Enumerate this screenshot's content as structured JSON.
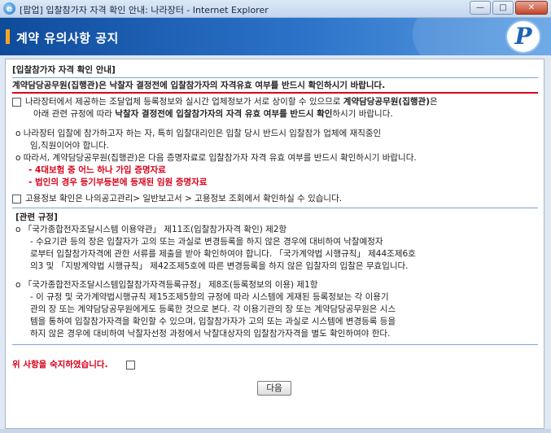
{
  "window": {
    "title": "[팝업] 입찰참가자 자격 확인 안내: 나라장터 - Internet Explorer",
    "minimize": "—",
    "maximize": "□",
    "close": "✕"
  },
  "header": {
    "title": "계약 유의사항 공지",
    "logo_letter": "P"
  },
  "content": {
    "section_title": "[입찰참가자 자격 확인 안내]",
    "main_notice": "계약담당공무원(집행관)은 낙찰자 결정전에 입찰참가자의 자격유효 여부를 반드시 확인하시기 바랍니다.",
    "p1_line1_a": "나라장터에서 제공하는 조달업체 등록정보와 실시간 업체정보가 서로 상이할 수 있으므로 ",
    "p1_line1_b": "계약담당공무원(집행관)",
    "p1_line1_c": "은",
    "p1_line2_a": "아래 관련 규정에 따라 ",
    "p1_line2_b": "낙찰자 결정전에 입찰참가자의 자격 유효 여부를 반드시 확인",
    "p1_line2_c": "하시기 바랍니다.",
    "p2_line1": "o 나라장터 입찰에 참가하고자 하는 자, 특히 입찰대리인은 입찰 당시 반드시 입찰참가 업체에 재직중인",
    "p2_line2": "임,직원이어야 합니다.",
    "p3_line1": "o 따라서, 계약담당공무원(집행관)은 다음 증명자료로 입찰참가자 자격 유효 여부를 반드시 확인하시기 바랍니다.",
    "p3_item1": "- 4대보험 중 어느 하나 가입 증명자료",
    "p3_item2": "- 법인의 경우 등기부등본에 등재된 임원 증명자료",
    "p4_line1": "고용정보 확인은 나의공고관리> 일반보고서 > 고용정보 조회에서 확인하실 수 있습니다.",
    "rel_title": "[관련 규정]",
    "r1_line1": "o 「국가종합전자조달시스템 이용약관」 제11조(입찰참가자격 확인) 제2항",
    "r1_line2": "- 수요기관 등의 장은 입찰자가 고의 또는 과실로 변경등록을 하지 않은 경우에 대비하여 낙찰예정자",
    "r1_line3": "로부터 입찰참가자격에 관한 서류를 제출을 받아 확인하여야 합니다. 「국가계약법 시행규칙」 제44조제6호",
    "r1_line4": "의3 및 「지방계약법 시행규칙」 제42조제5호에 따른 변경등록을 하지 않은 입찰자의 입찰은 무효입니다.",
    "r2_line1": "o 「국가종합전자조달시스템입찰참가자격등록규정」 제8조(등록정보의 이용) 제1항",
    "r2_line2": "- 이 규정 및 국가계약법시행규칙 제15조제5항의 규정에 따라 시스템에 게재된 등록정보는 각 이용기",
    "r2_line3": "관의 장 또는 계약담당공무원에게도 등록한 것으로 본다. 각 이용기관의 장 또는 계약담당공무원은 시스",
    "r2_line4": "템을 통하여 입찰참가자격을 확인할 수 있으며, 입찰참가자가 고의 또는 과실로 시스템에 변경등록 등을",
    "r2_line5": "하지 않은 경우에 대비하여 낙찰자선정 과정에서 낙찰대상자의 입찰참가자격을 별도 확인하여야 한다.",
    "agree_label": "위 사항을 숙지하였습니다.",
    "next_button": "다음"
  }
}
